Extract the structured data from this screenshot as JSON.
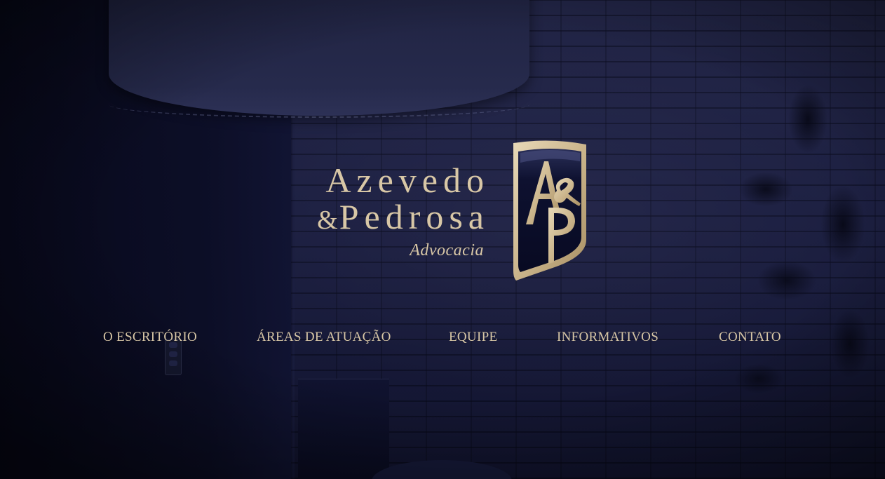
{
  "logo": {
    "line1": "Azevedo",
    "amp": "&",
    "line2": "Pedrosa",
    "line3": "Advocacia",
    "emblem_icon": "ap-shield-emblem-icon"
  },
  "nav": {
    "items": [
      {
        "label": "O ESCRITÓRIO"
      },
      {
        "label": "ÁREAS DE ATUAÇÃO"
      },
      {
        "label": "EQUIPE"
      },
      {
        "label": "INFORMATIVOS"
      },
      {
        "label": "CONTATO"
      }
    ]
  },
  "colors": {
    "gold": "#d8c7a6",
    "navy": "#0f1230"
  }
}
